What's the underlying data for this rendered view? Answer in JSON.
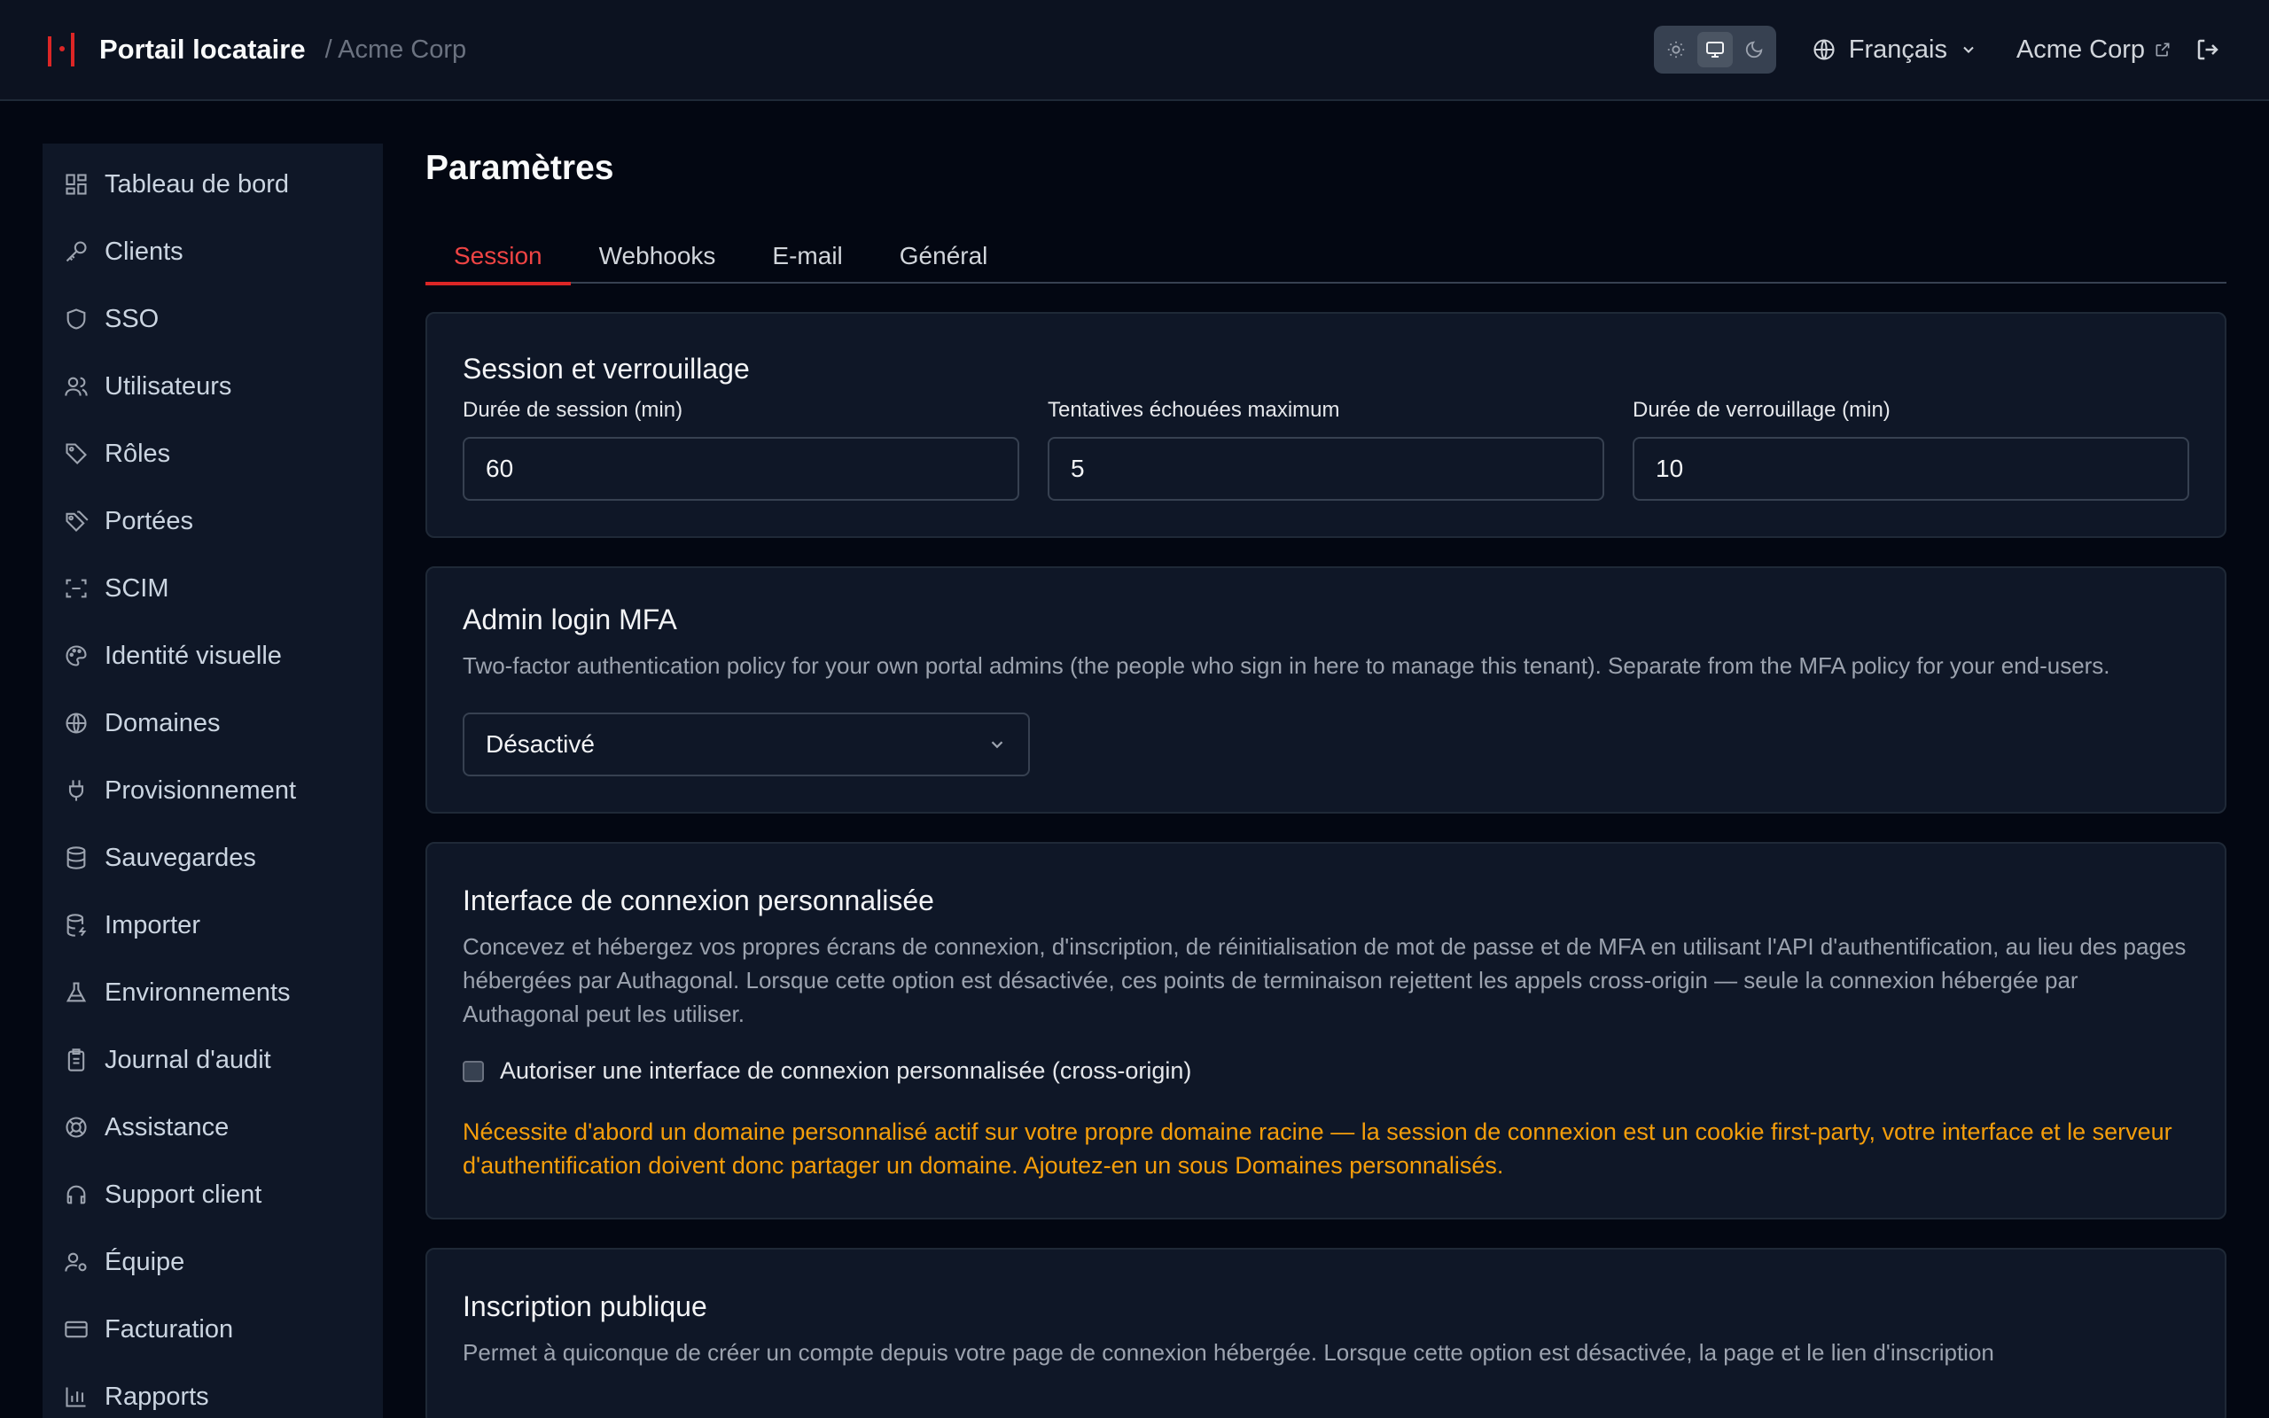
{
  "header": {
    "brand": "Portail locataire",
    "org": "/ Acme Corp",
    "language": "Français",
    "tenant_link": "Acme Corp"
  },
  "sidebar": {
    "items": [
      {
        "label": "Tableau de bord",
        "icon": "dashboard-icon"
      },
      {
        "label": "Clients",
        "icon": "key-icon"
      },
      {
        "label": "SSO",
        "icon": "shield-icon"
      },
      {
        "label": "Utilisateurs",
        "icon": "users-icon"
      },
      {
        "label": "Rôles",
        "icon": "tag-icon"
      },
      {
        "label": "Portées",
        "icon": "tags-icon"
      },
      {
        "label": "SCIM",
        "icon": "scan-icon"
      },
      {
        "label": "Identité visuelle",
        "icon": "palette-icon"
      },
      {
        "label": "Domaines",
        "icon": "globe-icon"
      },
      {
        "label": "Provisionnement",
        "icon": "plug-icon"
      },
      {
        "label": "Sauvegardes",
        "icon": "database-icon"
      },
      {
        "label": "Importer",
        "icon": "database-import-icon"
      },
      {
        "label": "Environnements",
        "icon": "flask-icon"
      },
      {
        "label": "Journal d'audit",
        "icon": "clipboard-icon"
      },
      {
        "label": "Assistance",
        "icon": "lifebuoy-icon"
      },
      {
        "label": "Support client",
        "icon": "headset-icon"
      },
      {
        "label": "Équipe",
        "icon": "user-cog-icon"
      },
      {
        "label": "Facturation",
        "icon": "credit-card-icon"
      },
      {
        "label": "Rapports",
        "icon": "bar-chart-icon"
      }
    ]
  },
  "main": {
    "title": "Paramètres",
    "tabs": [
      "Session",
      "Webhooks",
      "E-mail",
      "Général"
    ],
    "active_tab": "Session",
    "session": {
      "title": "Session et verrouillage",
      "fields": [
        {
          "label": "Durée de session (min)",
          "value": "60"
        },
        {
          "label": "Tentatives échouées maximum",
          "value": "5"
        },
        {
          "label": "Durée de verrouillage (min)",
          "value": "10"
        }
      ]
    },
    "mfa": {
      "title": "Admin login MFA",
      "description": "Two-factor authentication policy for your own portal admins (the people who sign in here to manage this tenant). Separate from the MFA policy for your end-users.",
      "selected": "Désactivé"
    },
    "custom_login": {
      "title": "Interface de connexion personnalisée",
      "description": "Concevez et hébergez vos propres écrans de connexion, d'inscription, de réinitialisation de mot de passe et de MFA en utilisant l'API d'authentification, au lieu des pages hébergées par Authagonal. Lorsque cette option est désactivée, ces points de terminaison rejettent les appels cross-origin — seule la connexion hébergée par Authagonal peut les utiliser.",
      "checkbox_label": "Autoriser une interface de connexion personnalisée (cross-origin)",
      "checked": false,
      "warning": "Nécessite d'abord un domaine personnalisé actif sur votre propre domaine racine — la session de connexion est un cookie first-party, votre interface et le serveur d'authentification doivent donc partager un domaine. Ajoutez-en un sous Domaines personnalisés."
    },
    "public_signup": {
      "title": "Inscription publique",
      "description": "Permet à quiconque de créer un compte depuis votre page de connexion hébergée. Lorsque cette option est désactivée, la page et le lien d'inscription"
    }
  },
  "colors": {
    "accent": "#dc2626",
    "warning": "#f59e0b",
    "background": "#030712",
    "panel": "#0f1727"
  }
}
